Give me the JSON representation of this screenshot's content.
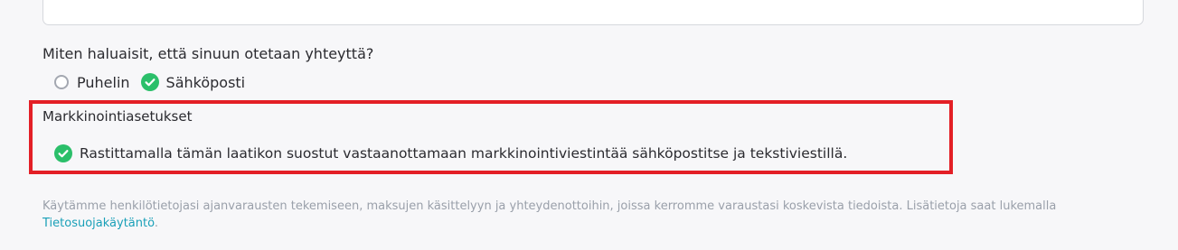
{
  "contact": {
    "question": "Miten haluaisit, että sinuun otetaan yhteyttä?",
    "options": [
      {
        "label": "Puhelin",
        "checked": false
      },
      {
        "label": "Sähköposti",
        "checked": true
      }
    ]
  },
  "marketing": {
    "title": "Markkinointiasetukset",
    "consent_label": "Rastittamalla tämän laatikon suostut vastaanottamaan markkinointiviestintää sähköpostitse ja tekstiviestillä.",
    "consent_checked": true
  },
  "privacy": {
    "text": "Käytämme henkilötietojasi ajanvarausten tekemiseen, maksujen käsittelyyn ja yhteydenottoihin, joissa kerromme varaustasi koskevista tiedoista. Lisätietoja saat lukemalla ",
    "link_label": "Tietosuojakäytäntö",
    "suffix": "."
  },
  "colors": {
    "check_green": "#2bbf6a",
    "highlight_red": "#e31f26",
    "link": "#1aa0b8"
  }
}
